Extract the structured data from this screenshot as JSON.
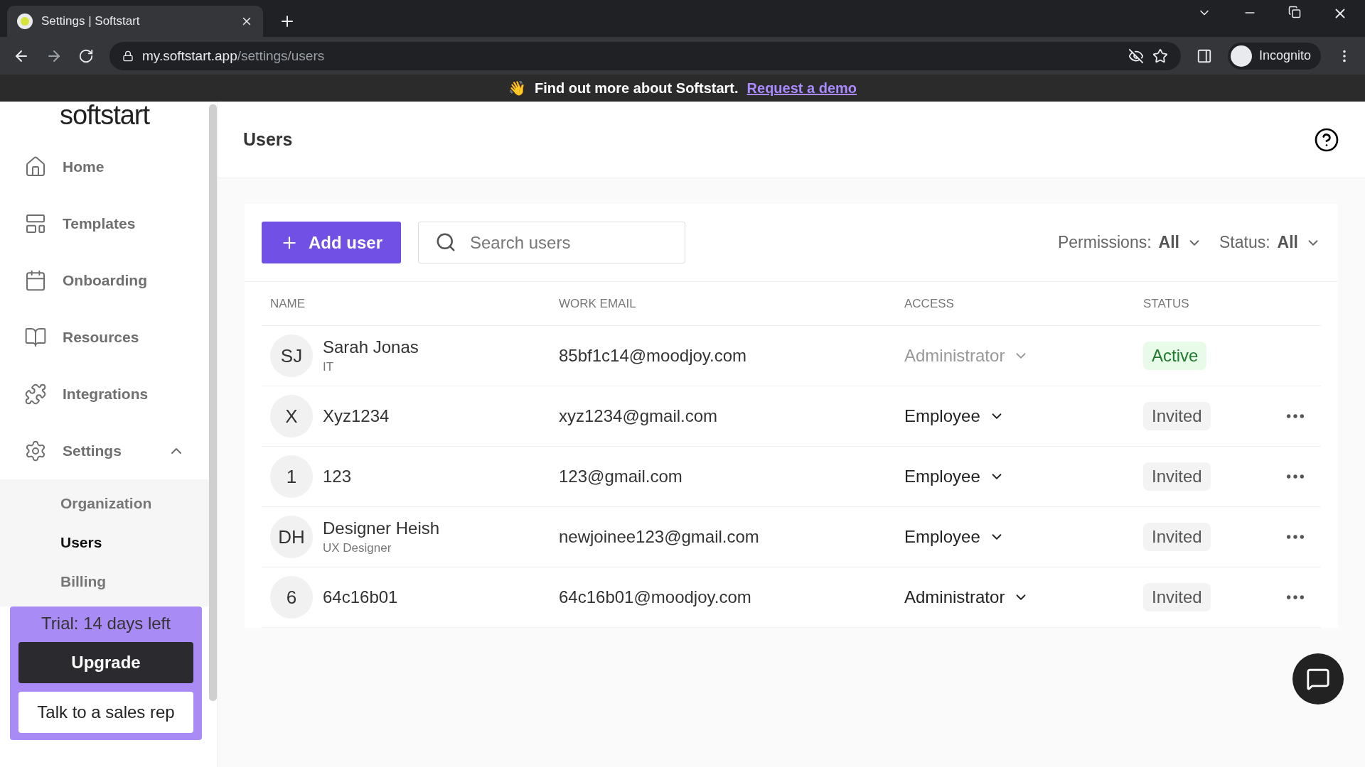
{
  "browser": {
    "tab_title": "Settings | Softstart",
    "url_host": "my.softstart.app",
    "url_path": "/settings/users",
    "profile": "Incognito"
  },
  "banner": {
    "emoji": "👋",
    "text": "Find out more about Softstart.",
    "link": "Request a demo"
  },
  "sidebar": {
    "logo": "softstart",
    "items": [
      {
        "label": "Home",
        "selected": false
      },
      {
        "label": "Templates",
        "selected": false
      },
      {
        "label": "Onboarding",
        "selected": false
      },
      {
        "label": "Resources",
        "selected": false
      },
      {
        "label": "Integrations",
        "selected": false
      },
      {
        "label": "Settings",
        "selected": false,
        "expanded": true,
        "children": [
          {
            "label": "Organization",
            "selected": false
          },
          {
            "label": "Users",
            "selected": true
          },
          {
            "label": "Billing",
            "selected": false
          }
        ]
      }
    ],
    "trial": {
      "text": "Trial: 14 days left",
      "upgrade": "Upgrade",
      "sales": "Talk to a sales rep"
    }
  },
  "page": {
    "title": "Users"
  },
  "toolbar": {
    "add_button": "Add user",
    "search": {
      "placeholder": "Search users"
    },
    "filters": [
      {
        "label": "Permissions:",
        "value": "All"
      },
      {
        "label": "Status:",
        "value": "All"
      }
    ]
  },
  "table": {
    "columns": [
      "NAME",
      "WORK EMAIL",
      "ACCESS",
      "STATUS"
    ],
    "rows": [
      {
        "initials": "SJ",
        "name": "Sarah Jonas",
        "subtitle": "IT",
        "email": "85bf1c14@moodjoy.com",
        "access": "Administrator",
        "access_disabled": true,
        "status": "Active",
        "kind": "active",
        "menu": false
      },
      {
        "initials": "X",
        "name": "Xyz1234",
        "email": "xyz1234@gmail.com",
        "access": "Employee",
        "access_disabled": false,
        "status": "Invited",
        "kind": "invited",
        "menu": true
      },
      {
        "initials": "1",
        "name": "123",
        "email": "123@gmail.com",
        "access": "Employee",
        "access_disabled": false,
        "status": "Invited",
        "kind": "invited",
        "menu": true
      },
      {
        "initials": "DH",
        "name": "Designer Heish",
        "subtitle": "UX Designer",
        "email": "newjoinee123@gmail.com",
        "access": "Employee",
        "access_disabled": false,
        "status": "Invited",
        "kind": "invited",
        "menu": true
      },
      {
        "initials": "6",
        "name": "64c16b01",
        "email": "64c16b01@moodjoy.com",
        "access": "Administrator",
        "access_disabled": false,
        "status": "Invited",
        "kind": "invited",
        "menu": true
      }
    ]
  }
}
